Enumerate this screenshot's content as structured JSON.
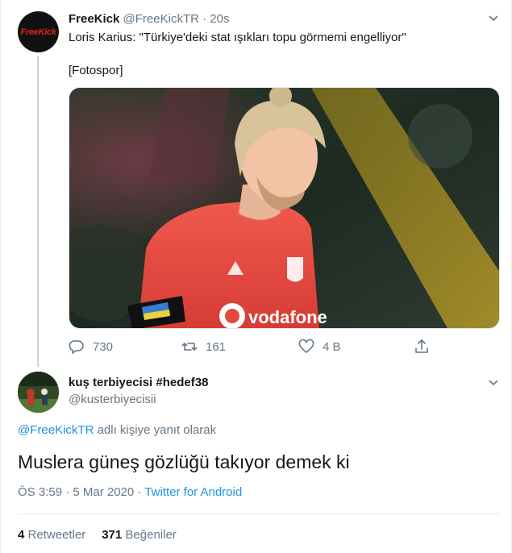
{
  "parent_tweet": {
    "display_name": "FreeKick",
    "handle": "@FreeKickTR",
    "separator": "·",
    "time": "20s",
    "avatar_logo_text": "FreeKick",
    "text": "Loris Karius: \"Türkiye'deki stat ışıkları topu görmemi engelliyor\"",
    "source": "[Fotospor]",
    "media_icon": "photo-of-goalkeeper",
    "jersey_sponsor_text": "vodafone",
    "actions": {
      "reply_count": "730",
      "retweet_count": "161",
      "like_count": "4 B"
    }
  },
  "reply_tweet": {
    "display_name": "kuş terbiyecisi #hedef38",
    "handle": "@kusterbiyecisii",
    "replying_mention": "@FreeKickTR",
    "replying_suffix": " adlı kişiye yanıt olarak",
    "text": "Muslera güneş gözlüğü takıyor demek ki",
    "timestamp": "ÖS 3:59 · 5 Mar 2020 · ",
    "client": "Twitter for Android",
    "retweet_count": "4",
    "retweet_label": "Retweetler",
    "like_count": "371",
    "like_label": "Beğeniler"
  },
  "colors": {
    "text_primary": "#14171a",
    "text_secondary": "#657786",
    "link_blue": "#1b95e0",
    "jersey_red": "#e8473f"
  }
}
